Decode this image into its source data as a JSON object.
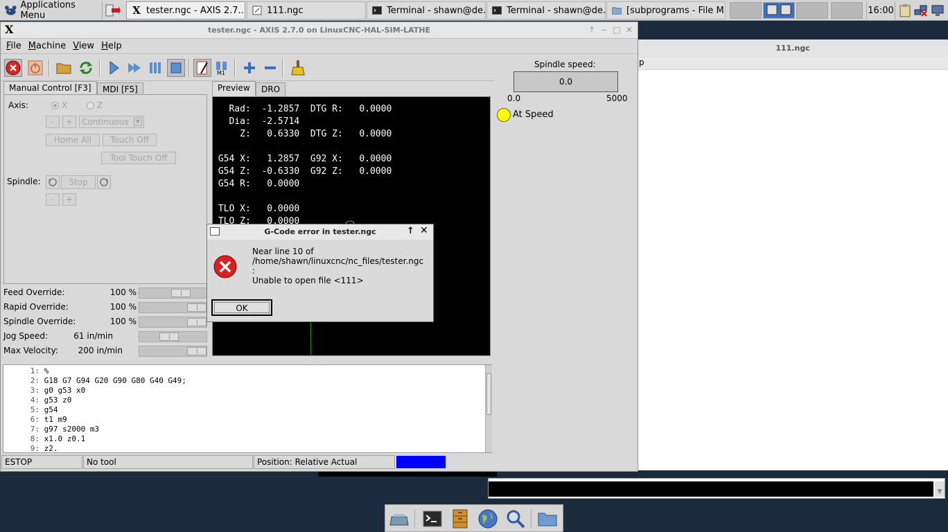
{
  "panel": {
    "applications_menu": "Applications Menu",
    "tasks": [
      {
        "label": "tester.ngc - AXIS 2.7...."
      },
      {
        "label": "111.ngc"
      },
      {
        "label": "Terminal - shawn@de..."
      },
      {
        "label": "Terminal - shawn@de..."
      },
      {
        "label": "[subprograms - File M..."
      }
    ],
    "clock": "16:00"
  },
  "background_window": {
    "title": "111.ngc",
    "strip_text": "p"
  },
  "axis": {
    "title": "tester.ngc - AXIS 2.7.0 on LinuxCNC-HAL-SIM-LATHE",
    "menus": [
      {
        "label": "File",
        "accel": "F",
        "rest": "ile"
      },
      {
        "label": "Machine",
        "accel": "M",
        "rest": "achine"
      },
      {
        "label": "View",
        "accel": "V",
        "rest": "iew"
      },
      {
        "label": "Help",
        "accel": "H",
        "rest": "elp"
      }
    ],
    "tabs_left": {
      "manual": "Manual Control [F3]",
      "mdi": "MDI [F5]"
    },
    "tabs_right": {
      "preview": "Preview",
      "dro": "DRO"
    },
    "manual": {
      "axis_label": "Axis:",
      "axis_x": "X",
      "axis_z": "Z",
      "minus": "-",
      "plus": "+",
      "increment": "Continuous",
      "home_all": "Home All",
      "touch_off": "Touch Off",
      "tool_touch_off": "Tool Touch Off",
      "spindle_label": "Spindle:",
      "stop": "Stop",
      "spindle_minus": "-",
      "spindle_plus": "+"
    },
    "overrides": [
      {
        "label": "Feed Override:",
        "value": "100 %",
        "fraction": 0.66
      },
      {
        "label": "Rapid Override:",
        "value": "100 %",
        "fraction": 1.0
      },
      {
        "label": "Spindle Override:",
        "value": "100 %",
        "fraction": 1.0
      },
      {
        "label": "Jog Speed:",
        "value": "61 in/min",
        "fraction": 0.42
      },
      {
        "label": "Max Velocity:",
        "value": "200 in/min",
        "fraction": 1.0
      }
    ],
    "dro": [
      "   Rad:  -1.2857  DTG R:   0.0000",
      "   Dia:  -2.5714",
      "     Z:   0.6330  DTG Z:   0.0000",
      "",
      " G54 X:   1.2857  G92 X:   0.0000",
      " G54 Z:  -0.6330  G92 Z:   0.0000",
      " G54 R:   0.0000",
      "",
      " TLO X:   0.0000",
      " TLO Z:   0.0000"
    ],
    "spindle_speed": {
      "label": "Spindle speed:",
      "value": "0.0",
      "min": "0.0",
      "max": "5000",
      "at_speed": "At Speed"
    },
    "gcode": [
      {
        "n": "1:",
        "text": "%"
      },
      {
        "n": "2:",
        "text": "G18 G7 G94 G20 G90 G80 G40 G49;"
      },
      {
        "n": "3:",
        "text": "g0 g53 x0"
      },
      {
        "n": "4:",
        "text": "g53 z0"
      },
      {
        "n": "5:",
        "text": "g54"
      },
      {
        "n": "6:",
        "text": "t1 m9"
      },
      {
        "n": "7:",
        "text": "g97 s2000 m3"
      },
      {
        "n": "8:",
        "text": "x1.0 z0.1"
      },
      {
        "n": "9:",
        "text": "z2."
      }
    ],
    "status": {
      "state": "ESTOP",
      "tool": "No tool",
      "position": "Position: Relative Actual"
    }
  },
  "dialog": {
    "title": "G-Code error in tester.ngc",
    "line1": "Near line 10 of",
    "line2": "/home/shawn/linuxcnc/nc_files/tester.ngc",
    "line3": ":",
    "line4": "Unable to open file <111>",
    "ok": "OK"
  },
  "colors": {
    "desktop": "#1c2a3e",
    "dro_background": "#000000",
    "at_speed_led": "#ffff00",
    "status_indicator": "#0000ff",
    "error_icon": "#d92020"
  }
}
